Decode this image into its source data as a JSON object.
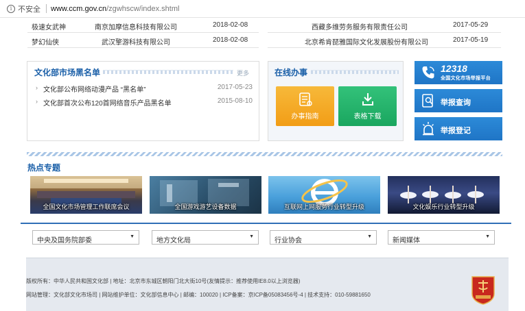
{
  "address_bar": {
    "security": "不安全",
    "host": "www.ccm.gov.cn",
    "path": "/zgwhscw/index.shtml"
  },
  "top_left_rows": [
    {
      "name": "极速女武神",
      "company": "南京加摩信息科技有限公司",
      "date": "2018-02-08"
    },
    {
      "name": "梦幻仙侠",
      "company": "武汉擎游科技有限公司",
      "date": "2018-02-08"
    }
  ],
  "top_right_rows": [
    {
      "company": "西藏多维劳务服务有限责任公司",
      "date": "2017-05-29"
    },
    {
      "company": "北京希肯琵雅国际文化发展股份有限公司",
      "date": "2017-05-19"
    }
  ],
  "blacklist": {
    "title": "文化部市场黑名单",
    "more": "更多",
    "items": [
      {
        "text": "文化部公布网络动漫产品 “黑名单”",
        "date": "2017-05-23"
      },
      {
        "text": "文化部首次公布120首网络音乐产品黑名单",
        "date": "2015-08-10"
      }
    ]
  },
  "online": {
    "title": "在线办事",
    "guide": "办事指南",
    "download": "表格下载"
  },
  "right_buttons": {
    "hotline_number": "12318",
    "hotline_sub": "全国文化市场举报平台",
    "query": "举报查询",
    "register": "举报登记"
  },
  "hot": {
    "title": "热点专题",
    "topics": [
      "全国文化市场管理工作联席会议",
      "全国游戏游艺设备数据",
      "互联网上网服务行业转型升级",
      "文化娱乐行业转型升级"
    ]
  },
  "selects": [
    "中央及国务院部委",
    "地方文化局",
    "行业协会",
    "新闻媒体"
  ],
  "footer": {
    "line1": "版权所有：中华人民共和国文化部 | 地址：北京市东城区朝阳门北大街10号(友情提示：推荐使用IE8.0以上浏览器)",
    "line2": "网站管理：文化部文化市场司 | 网站维护单位：文化部信息中心 | 邮编：100020 | ICP备案：京ICP备05083456号-4 | 技术支持：010-59881650"
  },
  "colors": {
    "accent": "#1a5fa8",
    "button_blue": "#1f75c6",
    "guide_orange": "#f29d16",
    "download_green": "#1aa65f",
    "footer_bg": "#e5e9ef"
  }
}
